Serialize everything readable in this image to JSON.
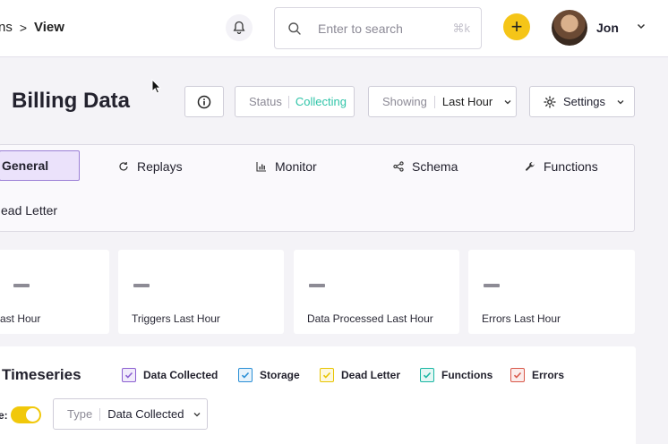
{
  "header": {
    "breadcrumb_prev": "ns",
    "breadcrumb_sep": ">",
    "breadcrumb_current": "View",
    "search_placeholder": "Enter to search",
    "search_shortcut": "⌘k",
    "add_label": "+",
    "user_name": "Jon"
  },
  "page": {
    "title": "Billing Data",
    "status_label": "Status",
    "status_value": "Collecting",
    "showing_label": "Showing",
    "showing_value": "Last Hour",
    "settings_label": "Settings"
  },
  "tabs": [
    {
      "label": "General",
      "icon": "none",
      "active": true
    },
    {
      "label": "Replays",
      "icon": "refresh-icon"
    },
    {
      "label": "Monitor",
      "icon": "bar-chart-icon"
    },
    {
      "label": "Schema",
      "icon": "share-icon"
    },
    {
      "label": "Functions",
      "icon": "wrench-icon"
    },
    {
      "label": "ead Letter",
      "icon": "none"
    }
  ],
  "stats": [
    {
      "value": "–",
      "label": "ast Hour"
    },
    {
      "value": "–",
      "label": "Triggers Last Hour"
    },
    {
      "value": "–",
      "label": "Data Processed Last Hour"
    },
    {
      "value": "–",
      "label": "Errors Last Hour"
    }
  ],
  "timeseries": {
    "title": "Timeseries",
    "legend": [
      {
        "label": "Data Collected",
        "color": "#8b5fd1"
      },
      {
        "label": "Storage",
        "color": "#2a8fd6"
      },
      {
        "label": "Dead Letter",
        "color": "#e8c400"
      },
      {
        "label": "Functions",
        "color": "#19b7a3"
      },
      {
        "label": "Errors",
        "color": "#d9584a"
      }
    ],
    "live_label": "e:",
    "type_label": "Type",
    "type_value": "Data Collected"
  },
  "colors": {
    "accent": "#f5c518",
    "status_green": "#2fc4a8",
    "active_tab_bg": "#ebe2fb",
    "active_tab_border": "#9b7fd6"
  }
}
